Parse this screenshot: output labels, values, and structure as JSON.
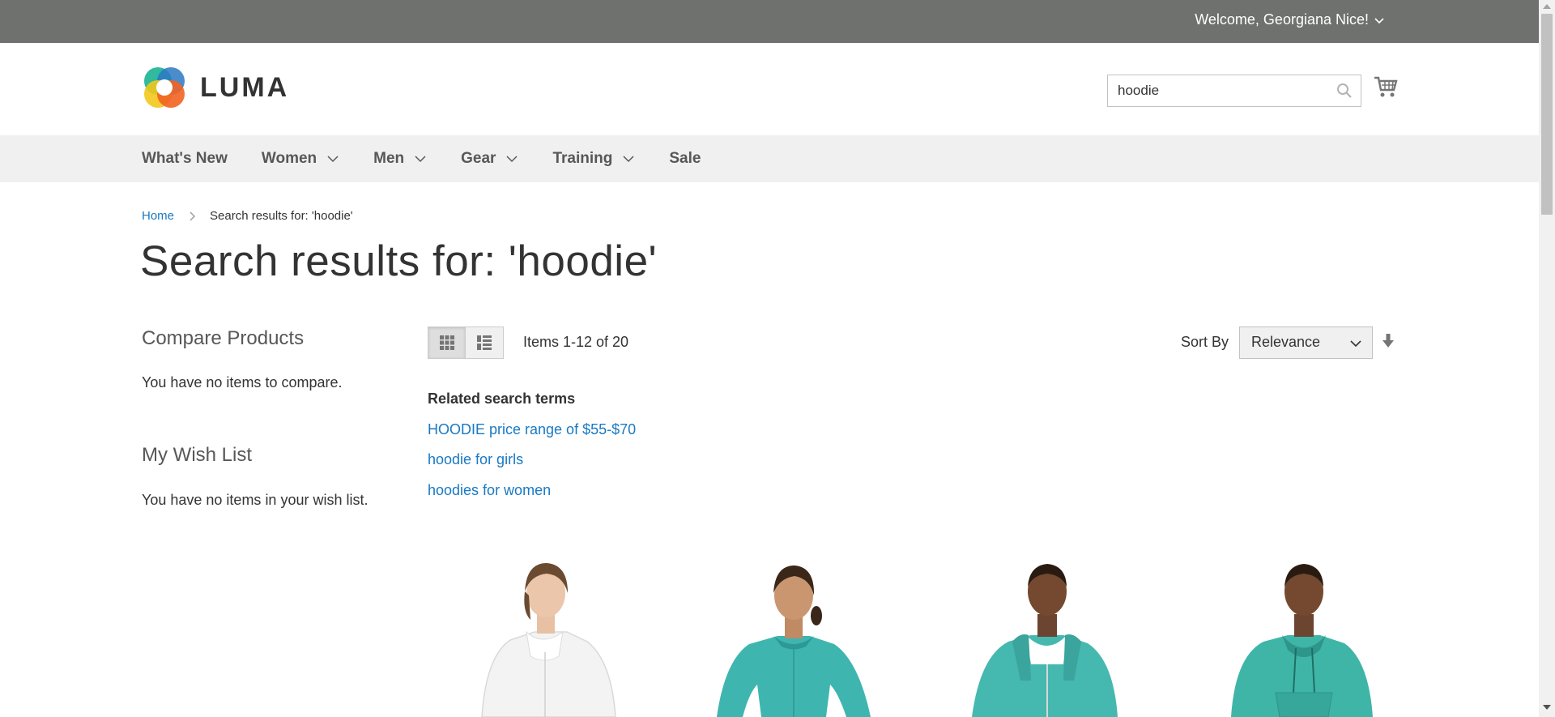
{
  "topbar": {
    "welcome": "Welcome, Georgiana Nice!"
  },
  "header": {
    "logo_text": "LUMA",
    "search_value": "hoodie"
  },
  "nav": {
    "items": [
      {
        "label": "What's New",
        "has_menu": false
      },
      {
        "label": "Women",
        "has_menu": true
      },
      {
        "label": "Men",
        "has_menu": true
      },
      {
        "label": "Gear",
        "has_menu": true
      },
      {
        "label": "Training",
        "has_menu": true
      },
      {
        "label": "Sale",
        "has_menu": false
      }
    ]
  },
  "breadcrumb": {
    "home": "Home",
    "current": "Search results for: 'hoodie'"
  },
  "page_title": "Search results for: 'hoodie'",
  "sidebar": {
    "compare_title": "Compare Products",
    "compare_empty": "You have no items to compare.",
    "wishlist_title": "My Wish List",
    "wishlist_empty": "You have no items in your wish list."
  },
  "toolbar": {
    "amount": "Items 1-12 of 20",
    "sort_label": "Sort By",
    "sort_value": "Relevance"
  },
  "related": {
    "title": "Related search terms",
    "links": [
      "HOODIE price range of $55-$70",
      "hoodie for girls",
      "hoodies for women"
    ]
  },
  "colors": {
    "accent": "#1979c3",
    "topbar": "#6e716e",
    "nav_bg": "#f0f0f0",
    "product_teal": "#3fb5b0"
  },
  "icons": [
    "chevron-down-icon",
    "search-icon",
    "cart-icon",
    "grid-icon",
    "list-icon",
    "sort-arrow-icon"
  ]
}
